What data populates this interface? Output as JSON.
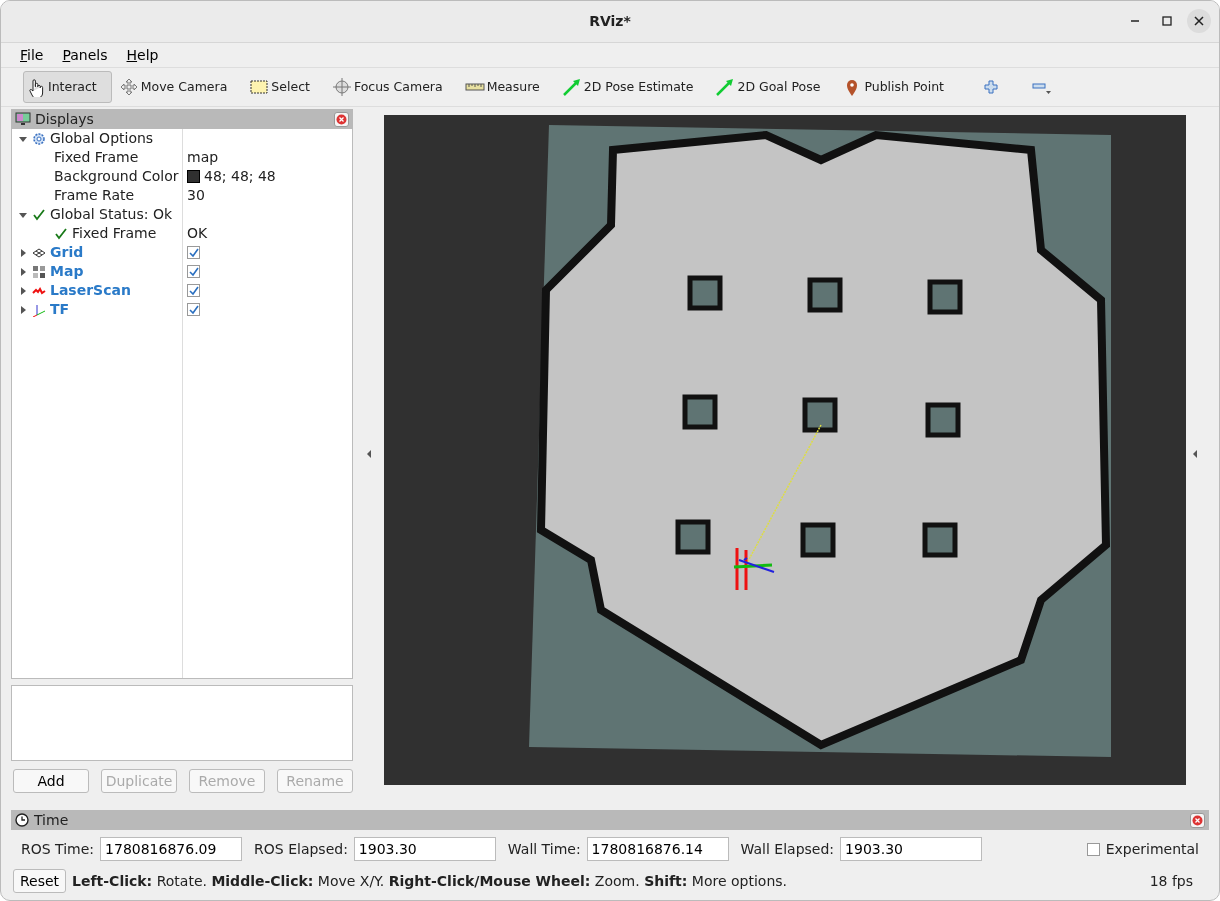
{
  "window": {
    "title": "RViz*"
  },
  "menu": [
    {
      "label": "File"
    },
    {
      "label": "Panels"
    },
    {
      "label": "Help"
    }
  ],
  "toolbar": {
    "tools": [
      {
        "label": "Interact",
        "selected": true
      },
      {
        "label": "Move Camera",
        "selected": false
      },
      {
        "label": "Select",
        "selected": false
      },
      {
        "label": "Focus Camera",
        "selected": false
      },
      {
        "label": "Measure",
        "selected": false
      },
      {
        "label": "2D Pose Estimate",
        "selected": false
      },
      {
        "label": "2D Goal Pose",
        "selected": false
      },
      {
        "label": "Publish Point",
        "selected": false
      }
    ]
  },
  "displays": {
    "title": "Displays",
    "tree": [
      {
        "label": "Global Options",
        "kind": "group",
        "expanded": true,
        "children": [
          {
            "label": "Fixed Frame",
            "value": "map",
            "kind": "property"
          },
          {
            "label": "Background Color",
            "value": "48; 48; 48",
            "kind": "color"
          },
          {
            "label": "Frame Rate",
            "value": "30",
            "kind": "property"
          }
        ]
      },
      {
        "label": "Global Status: Ok",
        "kind": "status",
        "expanded": true,
        "children": [
          {
            "label": "Fixed Frame",
            "value": "OK",
            "kind": "status"
          }
        ]
      },
      {
        "label": "Grid",
        "kind": "display",
        "expanded": false,
        "checked": true
      },
      {
        "label": "Map",
        "kind": "display",
        "expanded": false,
        "checked": true
      },
      {
        "label": "LaserScan",
        "kind": "display",
        "expanded": false,
        "checked": true
      },
      {
        "label": "TF",
        "kind": "display",
        "expanded": false,
        "checked": true
      }
    ],
    "buttons": [
      {
        "label": "Add",
        "disabled": false
      },
      {
        "label": "Duplicate",
        "disabled": true
      },
      {
        "label": "Remove",
        "disabled": true
      },
      {
        "label": "Rename",
        "disabled": true
      }
    ]
  },
  "time": {
    "title": "Time",
    "fields": [
      {
        "label": "ROS Time:",
        "value": "1780816876.09"
      },
      {
        "label": "ROS Elapsed:",
        "value": "1903.30"
      },
      {
        "label": "Wall Time:",
        "value": "1780816876.14"
      },
      {
        "label": "Wall Elapsed:",
        "value": "1903.30"
      }
    ],
    "experimental": {
      "label": "Experimental",
      "checked": false
    }
  },
  "status_bar": {
    "button": "Reset",
    "help": "**Left-Click:** Rotate. **Middle-Click:** Move X/Y. **Right-Click/Mouse Wheel:** Zoom. **Shift:** More options.",
    "fps": "18 fps"
  }
}
